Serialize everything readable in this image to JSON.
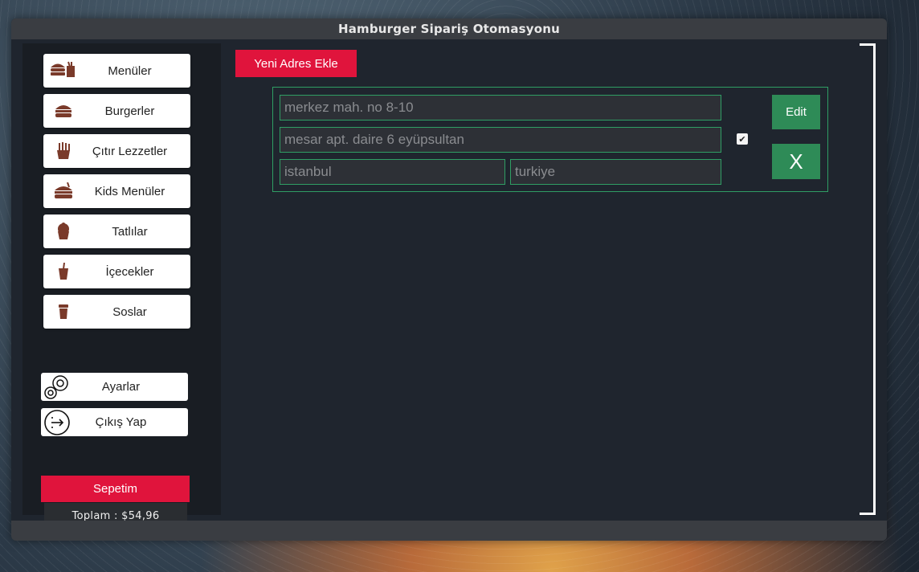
{
  "window": {
    "title": "Hamburger Sipariş Otomasyonu"
  },
  "sidebar": {
    "menu_items": [
      {
        "label": "Menüler",
        "icon": "burger-meal-icon"
      },
      {
        "label": "Burgerler",
        "icon": "burger-icon"
      },
      {
        "label": "Çıtır Lezzetler",
        "icon": "fries-icon"
      },
      {
        "label": "Kids Menüler",
        "icon": "kids-meal-icon"
      },
      {
        "label": "Tatlılar",
        "icon": "cupcake-icon"
      },
      {
        "label": "İçecekler",
        "icon": "drink-cup-icon"
      },
      {
        "label": "Soslar",
        "icon": "sauce-cup-icon"
      }
    ],
    "settings_label": "Ayarlar",
    "logout_label": "Çıkış Yap",
    "cart_label": "Sepetim",
    "total_text": "Toplam : $54,96"
  },
  "main": {
    "new_address_label": "Yeni Adres Ekle",
    "address": {
      "line1": "merkez mah. no 8-10",
      "line2": "mesar apt. daire 6 eyüpsultan",
      "city": "istanbul",
      "country": "turkiye",
      "selected": true,
      "edit_label": "Edit",
      "delete_label": "X"
    }
  },
  "colors": {
    "accent_red": "#e0143c",
    "accent_green": "#2e8b57",
    "icon_brown": "#7a3a2a",
    "panel_bg": "#1f252e"
  }
}
